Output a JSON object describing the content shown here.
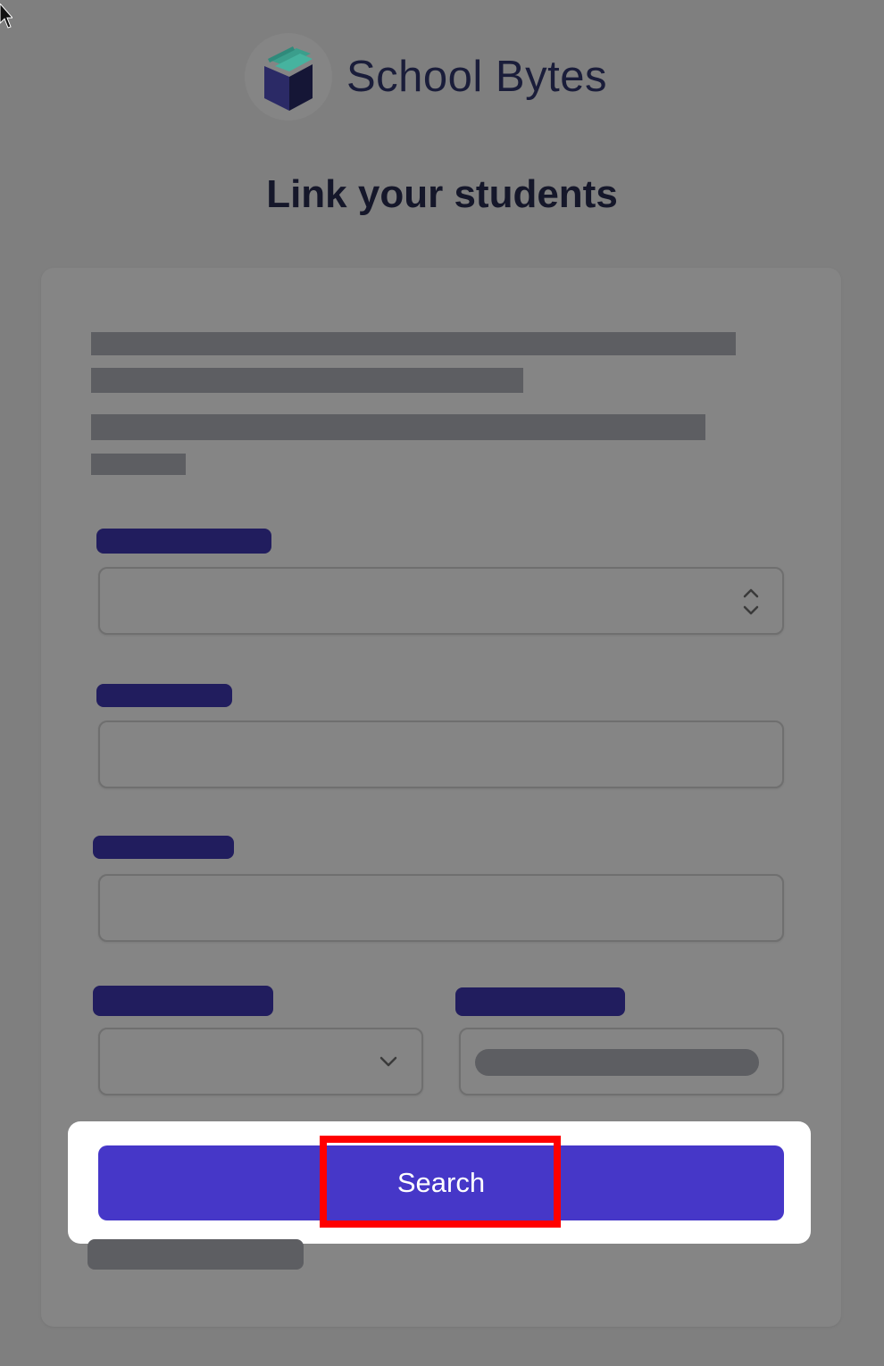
{
  "brand": {
    "name": "School Bytes",
    "colors": {
      "book_front": "#2b2a66",
      "book_side": "#151636",
      "book_pages": "#3b9e8c"
    }
  },
  "page": {
    "title": "Link your students"
  },
  "form": {
    "submit_label": "Search",
    "colors": {
      "submit_bg": "#4637c8",
      "highlight_border": "#ff0000",
      "label_redaction": "#211d5e",
      "text_redaction": "#5d5e62"
    }
  },
  "icons": {
    "cursor": "mouse-pointer",
    "select_updown": "chevron-up-down-icon",
    "select_down": "chevron-down-icon"
  }
}
